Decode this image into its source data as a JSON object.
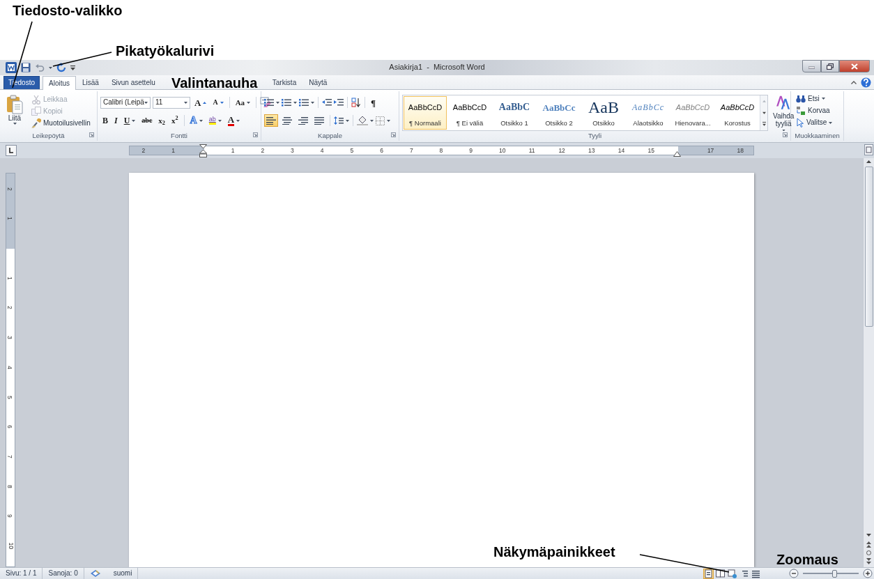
{
  "annotations": [
    {
      "text": "Tiedosto-valikko"
    },
    {
      "text": "Pikatyökalurivi"
    },
    {
      "text": "Valintanauha"
    },
    {
      "text": "Näkymäpainikkeet"
    },
    {
      "text": "Zoomaus"
    }
  ],
  "window": {
    "title": "Asiakirja1  -  Microsoft Word"
  },
  "tabs": [
    {
      "label": "Tiedosto",
      "kind": "file",
      "selected": false
    },
    {
      "label": "Aloitus",
      "kind": "tab",
      "selected": true
    },
    {
      "label": "Lisää",
      "kind": "tab",
      "selected": false
    },
    {
      "label": "Sivun asettelu",
      "kind": "tab",
      "selected": false
    },
    {
      "label": "Tarkista",
      "kind": "tab",
      "selected": false
    },
    {
      "label": "Näytä",
      "kind": "tab",
      "selected": false
    }
  ],
  "clipboard": {
    "label": "Leikepöytä",
    "paste": "Liitä",
    "items": [
      {
        "label": "Leikkaa",
        "kind": "cut",
        "disabled": true
      },
      {
        "label": "Kopioi",
        "kind": "copy",
        "disabled": true
      },
      {
        "label": "Muotoilusivellin",
        "kind": "painter",
        "disabled": false
      }
    ]
  },
  "font": {
    "label": "Fontti",
    "name": "Calibri (Leipä",
    "size": "11",
    "grow": "A",
    "shrink": "A",
    "case": "Aa",
    "bold": "B",
    "italic": "I",
    "underline": "U",
    "strike": "abc",
    "subscript": "x$_{2}$",
    "superscript": "x$^{2}$",
    "effects": "A",
    "highlight": "ab",
    "font_color": "A"
  },
  "paragraph": {
    "label": "Kappale",
    "show_marks": "¶",
    "alignment": [
      {
        "selected": true
      },
      {
        "selected": false
      },
      {
        "selected": false
      },
      {
        "selected": false
      }
    ]
  },
  "styles": {
    "label": "Tyyli",
    "change": "Vaihda tyyliä",
    "items": [
      {
        "sample": "AaBbCcD",
        "label": "¶ Normaali",
        "kind": "normal",
        "selected": true
      },
      {
        "sample": "AaBbCcD",
        "label": "¶ Ei väliä",
        "kind": "normal",
        "selected": false
      },
      {
        "sample": "AaBbC",
        "label": "Otsikko 1",
        "kind": "heading1",
        "selected": false
      },
      {
        "sample": "AaBbCc",
        "label": "Otsikko 2",
        "kind": "heading2",
        "selected": false
      },
      {
        "sample": "AaB",
        "label": "Otsikko",
        "kind": "title",
        "selected": false
      },
      {
        "sample": "AaBbCc",
        "label": "Alaotsikko",
        "kind": "subtitle",
        "selected": false
      },
      {
        "sample": "AaBbCcD",
        "label": "Hienovara...",
        "kind": "subtle",
        "selected": false
      },
      {
        "sample": "AaBbCcD",
        "label": "Korostus",
        "kind": "emphasis",
        "selected": false
      }
    ]
  },
  "editing": {
    "label": "Muokkaaminen",
    "items": [
      {
        "label": "Etsi",
        "kind": "find"
      },
      {
        "label": "Korvaa",
        "kind": "replace"
      },
      {
        "label": "Valitse",
        "kind": "select"
      }
    ]
  },
  "ruler": {
    "horizontal": [
      "2",
      "1",
      "1",
      "2",
      "3",
      "4",
      "5",
      "6",
      "7",
      "8",
      "9",
      "10",
      "11",
      "12",
      "13",
      "14",
      "15",
      "17",
      "18"
    ],
    "vertical": [
      "2",
      "1",
      "1",
      "2",
      "3",
      "4",
      "5",
      "6",
      "7",
      "8",
      "9",
      "10"
    ]
  },
  "status_bar": {
    "page": "Sivu: 1 / 1",
    "words": "Sanoja: 0",
    "language": "suomi",
    "views": [
      {
        "selected": true
      },
      {
        "selected": false
      },
      {
        "selected": false
      },
      {
        "selected": false
      },
      {
        "selected": false
      }
    ],
    "zoom": {
      "level": 0.56
    }
  }
}
